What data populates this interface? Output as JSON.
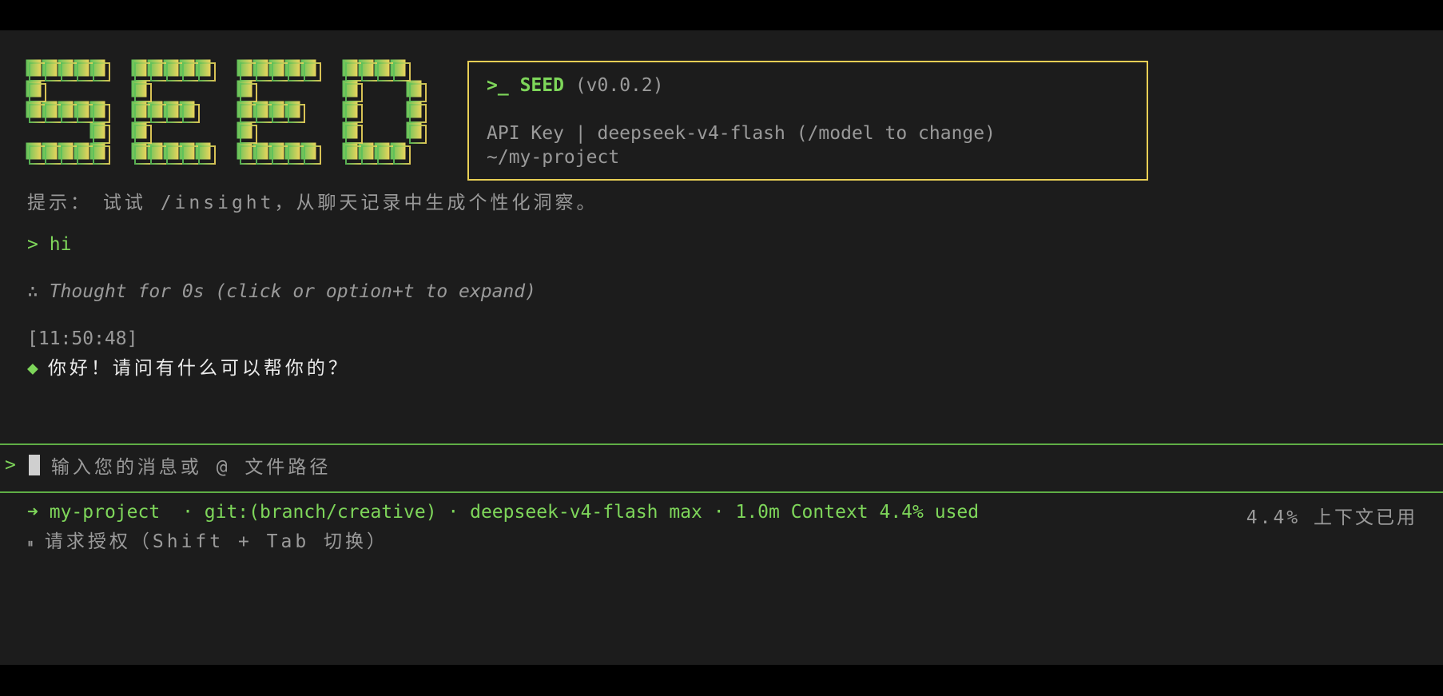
{
  "banner": {
    "prompt_symbol": ">_",
    "app_name": "SEED",
    "version": "(v0.0.2)",
    "auth_line": "API Key | deepseek-v4-flash (/model to change)",
    "cwd": "~/my-project",
    "border_color": "#e8cf55"
  },
  "logo": {
    "gradient_start": "#5cc15a",
    "gradient_end": "#eed55c"
  },
  "tip": {
    "label": "提示：",
    "text": "试试 /insight，从聊天记录中生成个性化洞察。"
  },
  "user_message": {
    "prompt": ">",
    "text": "hi"
  },
  "thought": "∴ Thought for 0s (click or option+t to expand)",
  "assistant": {
    "timestamp": "[11:50:48]",
    "bullet": "◆",
    "text": "你好！请问有什么可以帮你的？"
  },
  "input": {
    "prompt": ">",
    "placeholder": "输入您的消息或 @ 文件路径"
  },
  "status": {
    "arrow": "➜",
    "project": "my-project",
    "git": "· git:(branch/creative)",
    "model": "· deepseek-v4-flash max",
    "context": "· 1.0m Context 4.4% used",
    "right": "4.4% 上下文已用",
    "permission_icon": "⏸",
    "permission": "请求授权（Shift + Tab 切换）"
  },
  "colors": {
    "accent_green": "#7ed65a",
    "muted": "#9a9a9a",
    "background": "#1c1c1c"
  }
}
